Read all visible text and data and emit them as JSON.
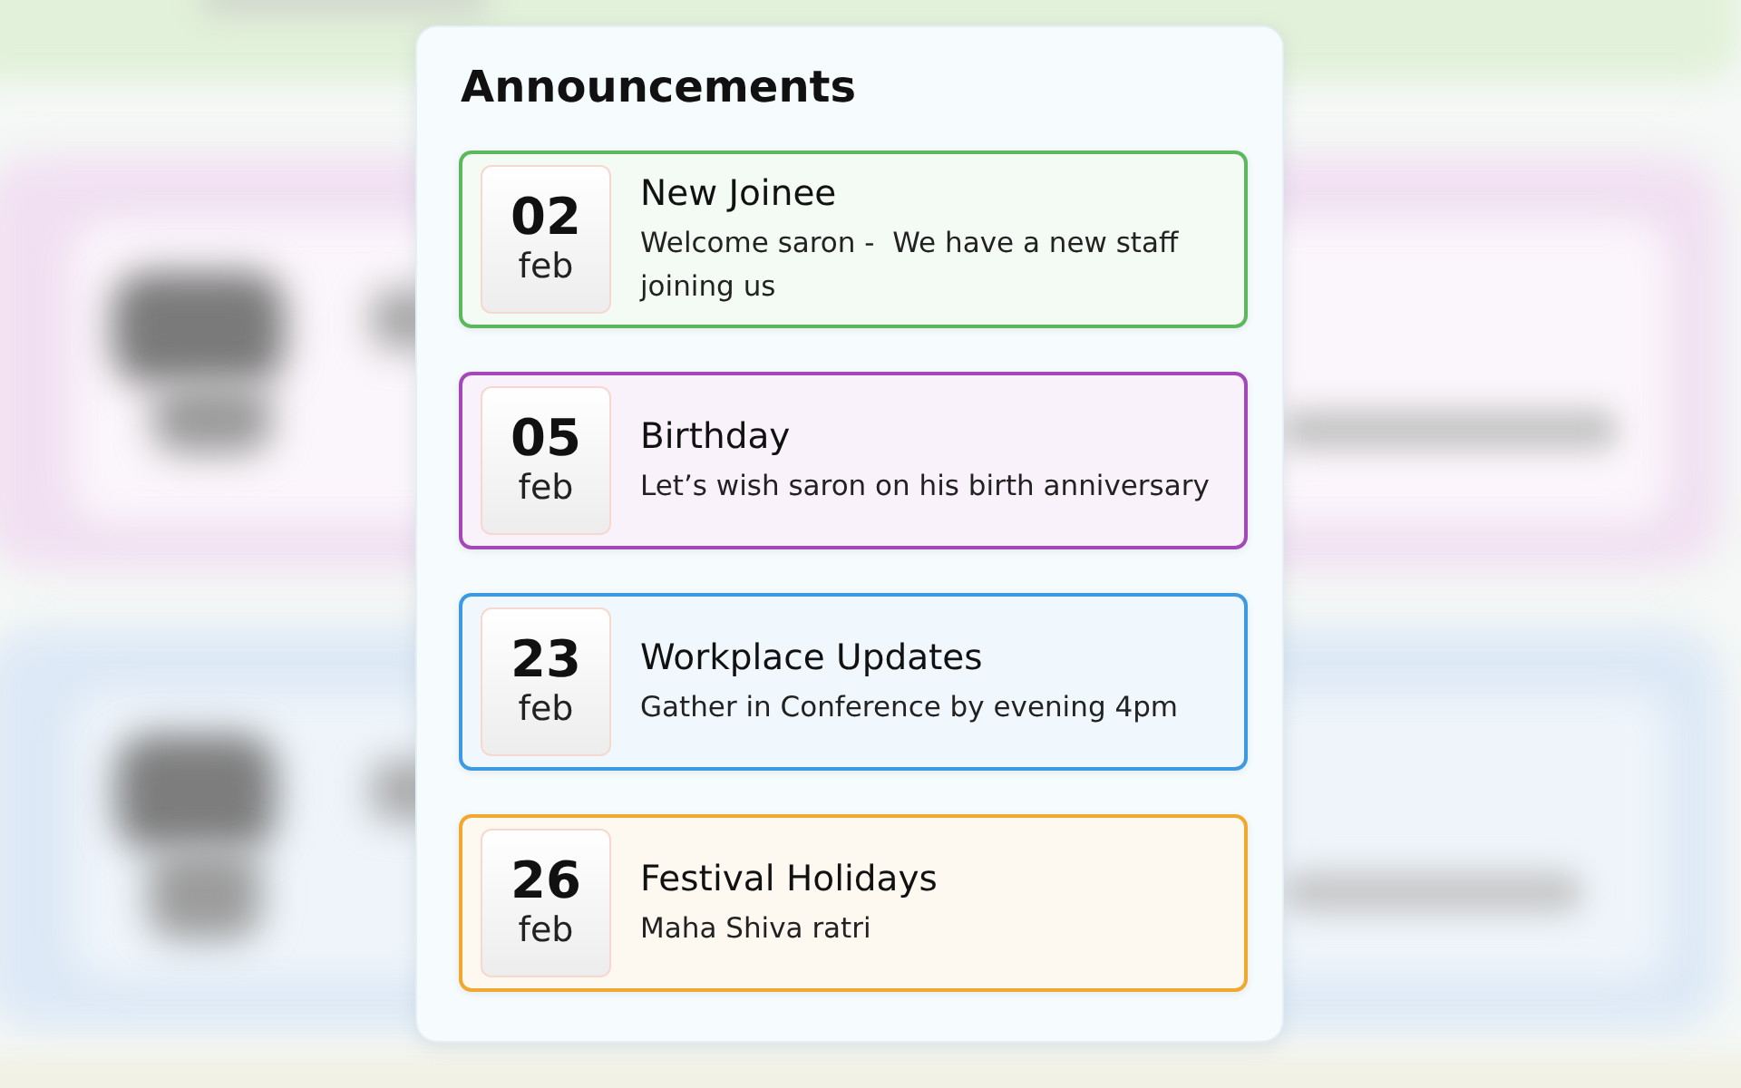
{
  "title": "Announcements",
  "items": [
    {
      "day": "02",
      "month": "feb",
      "title": "New Joinee",
      "text": "Welcome saron -  We have a new staff joining us",
      "color": "#5cb85c"
    },
    {
      "day": "05",
      "month": "feb",
      "title": "Birthday",
      "text": "Let’s wish saron on his birth anniversary",
      "color": "#a347ba"
    },
    {
      "day": "23",
      "month": "feb",
      "title": "Workplace Updates",
      "text": "Gather in Conference by evening 4pm",
      "color": "#3d9ae2"
    },
    {
      "day": "26",
      "month": "feb",
      "title": "Festival Holidays",
      "text": "Maha Shiva ratri",
      "color": "#f0a92e"
    }
  ]
}
